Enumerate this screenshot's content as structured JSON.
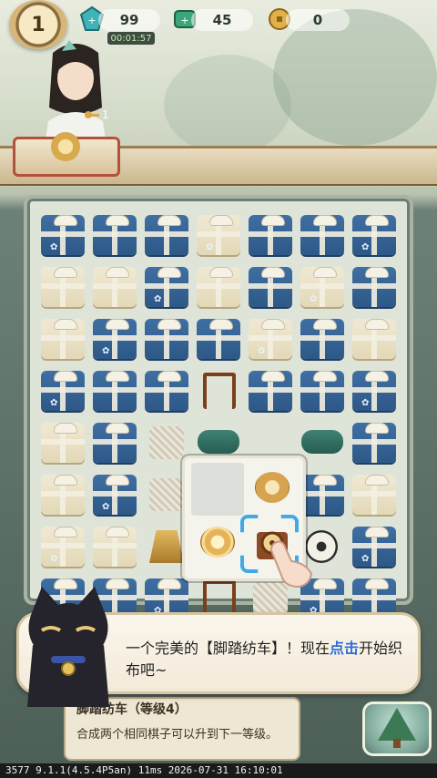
{
  "hud": {
    "level": "1",
    "gems": "99",
    "timer": "00:01:57",
    "energy": "45",
    "coins": "0",
    "key_count": "1"
  },
  "dialog": {
    "text_pre": "一个完美的【脚踏纺车】！现在",
    "text_highlight": "点击",
    "text_post": "开始织布吧~"
  },
  "info_panel": {
    "title": "脚踏纺车（等级4）",
    "description": "合成两个相同棋子可以升到下一等级。"
  },
  "status_bar": "3577 9.1.1(4.5.4P5an) 11ms 2026-07-31 16:10:01",
  "colors": {
    "accent_blue": "#2d6fd8",
    "box_blue": "#3f6fa3",
    "select_border": "#40a9e8"
  }
}
